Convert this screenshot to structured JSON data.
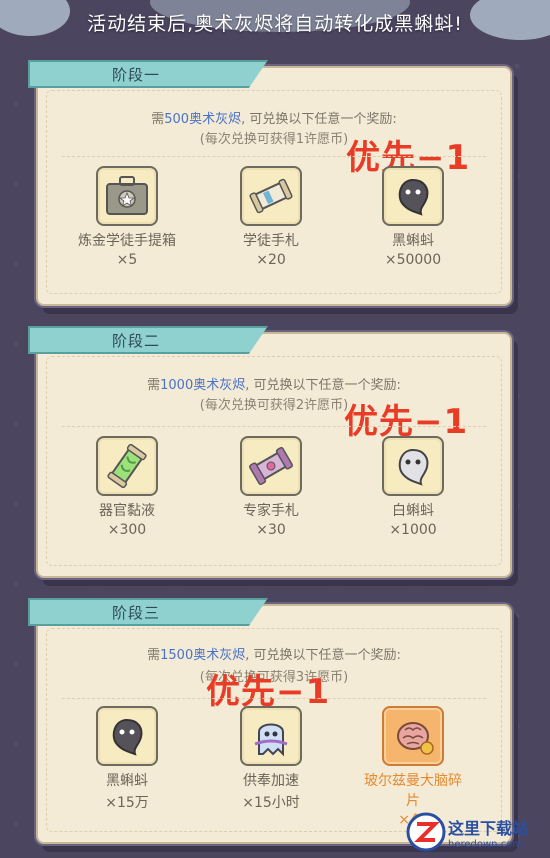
{
  "header": {
    "notice": "活动结束后,奥术灰烬将自动转化成黑蝌蚪!"
  },
  "stages": [
    {
      "title": "阶段一",
      "req_prefix": "需",
      "req_amount": "500奥术灰烬",
      "req_suffix": ", 可兑换以下任意一个奖励:",
      "sub": "(每次兑换可获得1许愿币)",
      "priority": "优先−1",
      "items": [
        {
          "name": "炼金学徒手提箱",
          "qty": "×5",
          "icon": "briefcase-icon"
        },
        {
          "name": "学徒手札",
          "qty": "×20",
          "icon": "scroll-icon"
        },
        {
          "name": "黑蝌蚪",
          "qty": "×50000",
          "icon": "black-tadpole-icon"
        }
      ]
    },
    {
      "title": "阶段二",
      "req_prefix": "需",
      "req_amount": "1000奥术灰烬",
      "req_suffix": ", 可兑换以下任意一个奖励:",
      "sub": "(每次兑换可获得2许愿币)",
      "priority": "优先−1",
      "items": [
        {
          "name": "器官黏液",
          "qty": "×300",
          "icon": "slime-tube-icon"
        },
        {
          "name": "专家手札",
          "qty": "×30",
          "icon": "expert-scroll-icon"
        },
        {
          "name": "白蝌蚪",
          "qty": "×1000",
          "icon": "white-tadpole-icon"
        }
      ]
    },
    {
      "title": "阶段三",
      "req_prefix": "需",
      "req_amount": "1500奥术灰烬",
      "req_suffix": ", 可兑换以下任意一个奖励:",
      "sub": "(每次兑换可获得3许愿币)",
      "priority": "优先−1",
      "items": [
        {
          "name": "黑蝌蚪",
          "qty": "×15万",
          "icon": "black-tadpole-icon"
        },
        {
          "name": "供奉加速",
          "qty": "×15小时",
          "icon": "ghost-icon"
        },
        {
          "name": "玻尔兹曼大脑碎片",
          "qty": "×40",
          "icon": "brain-icon"
        }
      ]
    }
  ],
  "watermark": {
    "title": "这里下载站",
    "url": "heredown.com"
  },
  "colors": {
    "accent": "#4a72c4",
    "priority": "#e83c26",
    "ribbon": "#8fd1cf",
    "card": "#f4ebd7"
  }
}
